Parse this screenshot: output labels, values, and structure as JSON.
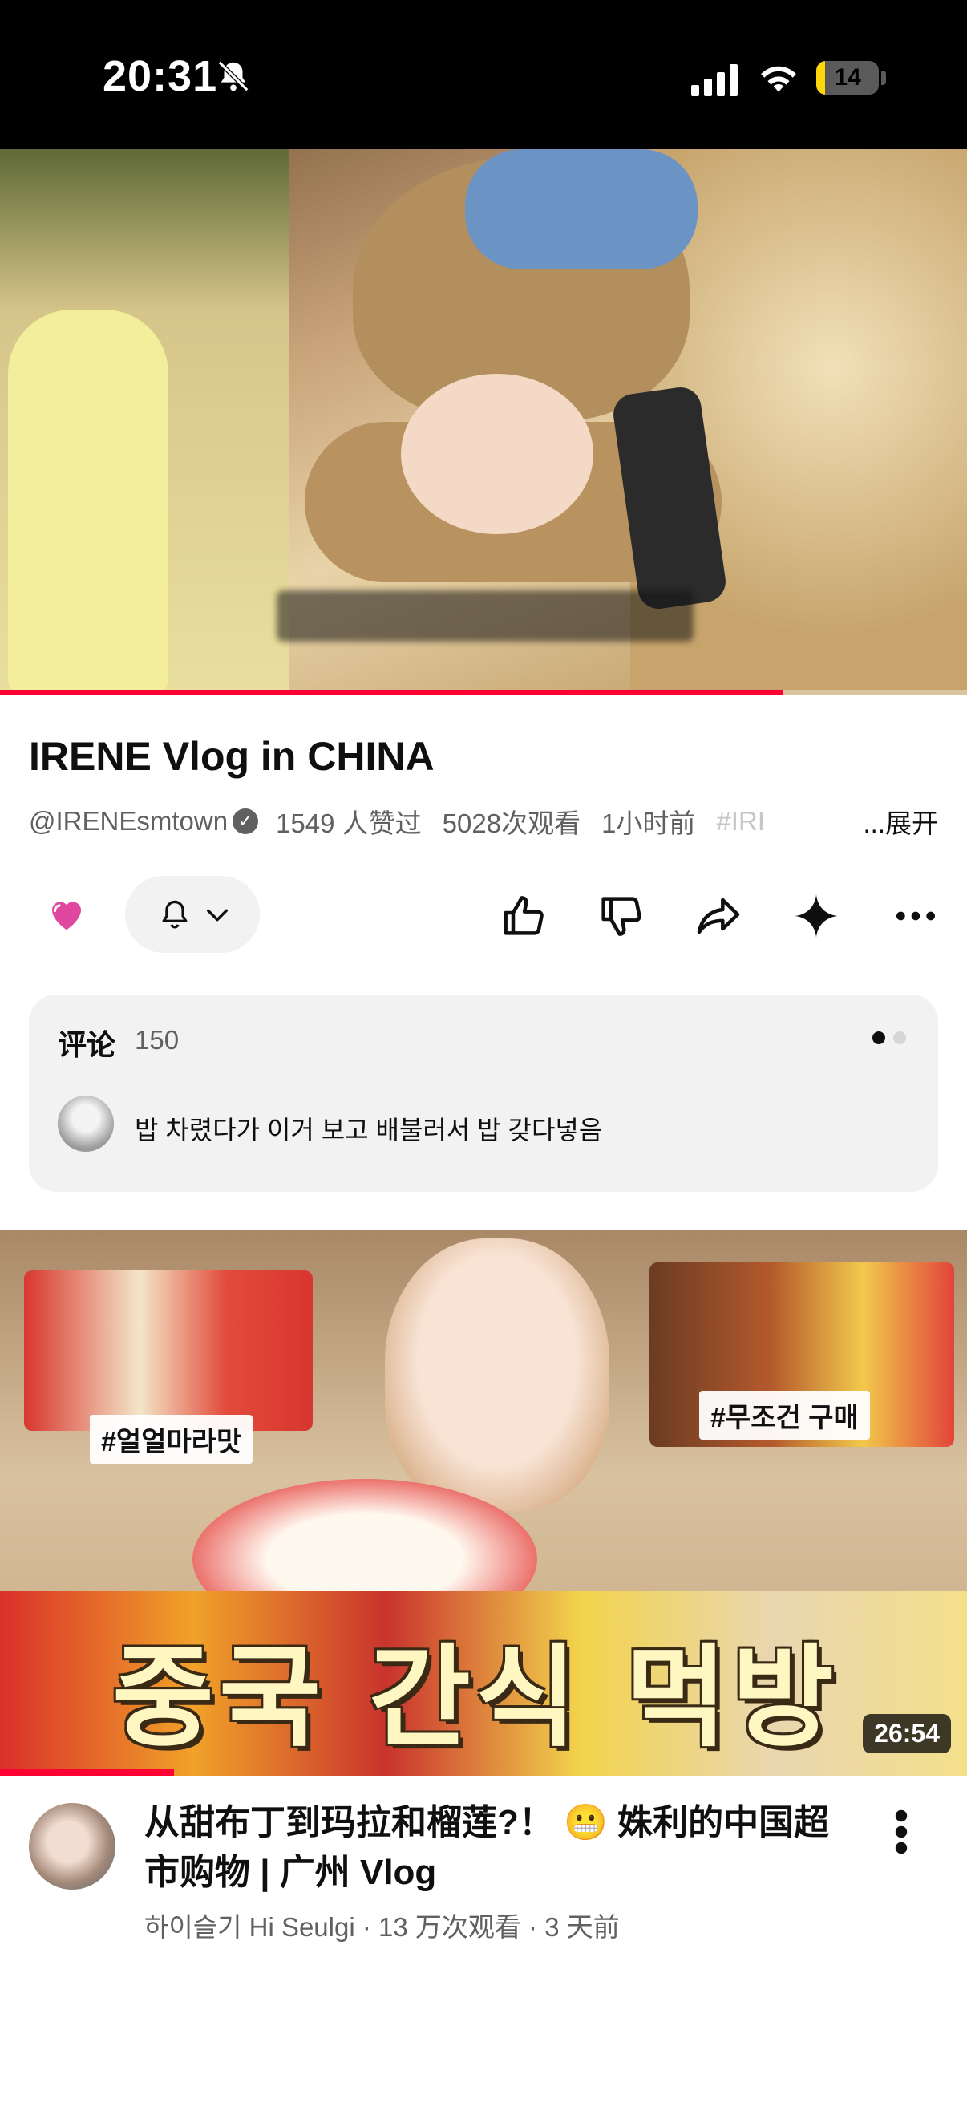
{
  "status_bar": {
    "time": "20:31",
    "battery_level": "14",
    "battery_fraction": 0.14
  },
  "player": {
    "progress_fraction": 0.81
  },
  "video": {
    "title": "IRENE Vlog in CHINA",
    "channel": "@IRENEsmtown",
    "likes": "1549 人赞过",
    "views": "5028次观看",
    "age": "1小时前",
    "hashtag_partial": "#IRI",
    "expand_label": "...展开"
  },
  "actions": {
    "icons": [
      "heart-icon",
      "bell-icon",
      "chevron-down-icon",
      "thumbs-up-icon",
      "thumbs-down-icon",
      "share-icon",
      "sparkle-icon",
      "more-icon"
    ]
  },
  "comments": {
    "title": "评论",
    "count": "150",
    "top_comment": "밥 차렸다가 이거 보고 배불러서 밥 갖다넣음"
  },
  "recommended": {
    "tag_left": "#얼얼마라맛",
    "tag_right": "#무조건 구매",
    "overlay_text": "중국 간식 먹방",
    "duration": "26:54",
    "progress_fraction": 0.18,
    "title": "从甜布丁到玛拉和榴莲?！ 😬 姝利的中国超市购物 | 广州 Vlog",
    "channel": "하이슬기 Hi Seulgi",
    "views": "13 万次观看",
    "age": "3 天前",
    "separator": " · "
  },
  "colors": {
    "accent_red": "#ff0033",
    "heart_pink": "#e0479e",
    "muted_text": "#606060",
    "chip_bg": "#f2f2f2"
  }
}
